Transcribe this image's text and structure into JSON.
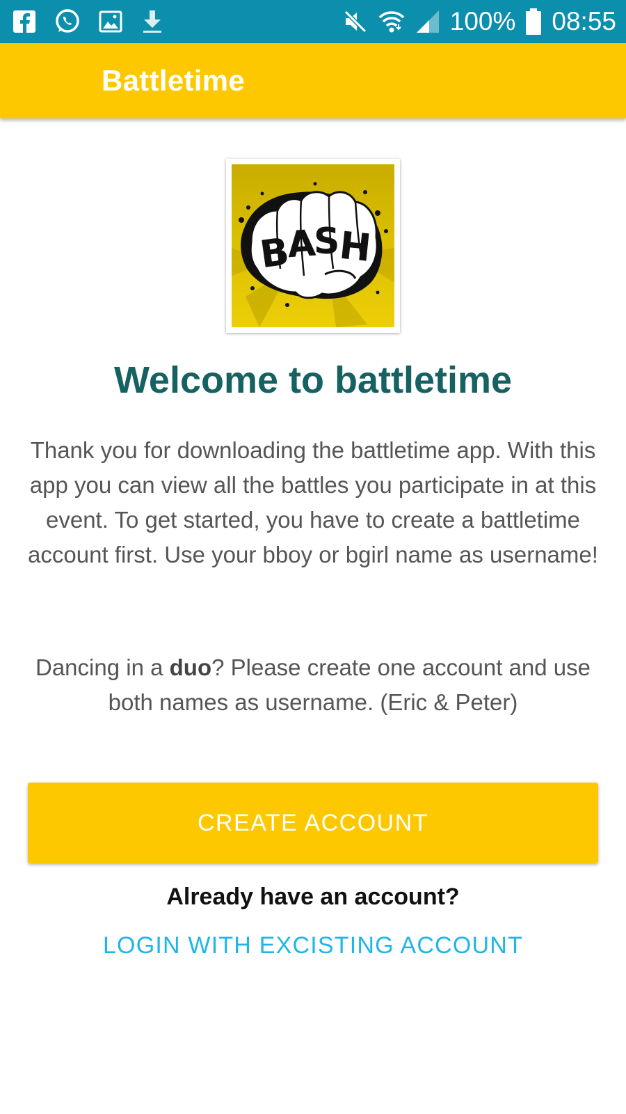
{
  "status_bar": {
    "left_icons": [
      "facebook-icon",
      "whatsapp-icon",
      "gallery-icon",
      "download-icon"
    ],
    "right_icons": [
      "mute-icon",
      "wifi-icon",
      "signal-icon",
      "battery-icon"
    ],
    "battery": "100%",
    "time": "08:55",
    "background": "#0b8fac"
  },
  "app_bar": {
    "title": "Battletime",
    "background": "#fec800"
  },
  "logo": {
    "text": "BASH",
    "icon": "bash-fist-logo"
  },
  "content": {
    "welcome": "Welcome to battletime",
    "intro": "Thank you for downloading the battletime app. With this app you can view all the battles you participate in at this event. To get started, you have to create a battletime account first. Use your bboy or bgirl name as username!",
    "duo_before": "Dancing in a ",
    "duo_bold": "duo",
    "duo_after": "? Please create one account and use both names as username. (Eric & Peter)",
    "welcome_color": "#166161"
  },
  "actions": {
    "create_label": "CREATE ACCOUNT",
    "already_text": "Already have an account?",
    "login_label": "LOGIN WITH EXCISTING ACCOUNT",
    "link_color": "#1eb6e8"
  }
}
